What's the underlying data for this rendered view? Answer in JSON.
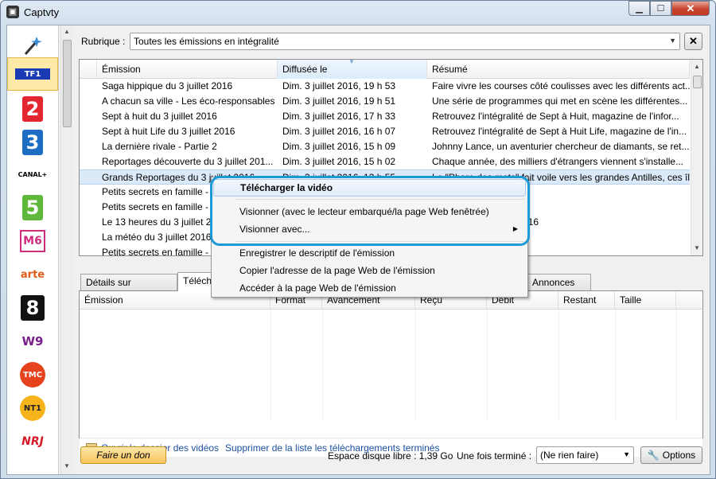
{
  "window": {
    "title": "Captvty"
  },
  "channels": [
    {
      "name": "magic-wand",
      "label": ""
    },
    {
      "name": "tf1",
      "label": "TF1"
    },
    {
      "name": "france-2",
      "label": "2"
    },
    {
      "name": "france-3",
      "label": "3"
    },
    {
      "name": "canal-plus",
      "label": "CANAL+"
    },
    {
      "name": "france-5",
      "label": "5"
    },
    {
      "name": "m6",
      "label": "M6"
    },
    {
      "name": "arte",
      "label": "arte"
    },
    {
      "name": "d8",
      "label": "8"
    },
    {
      "name": "w9",
      "label": "W9"
    },
    {
      "name": "tmc",
      "label": "TMC"
    },
    {
      "name": "nt1",
      "label": "NT1"
    },
    {
      "name": "nrj12",
      "label": "NRJ"
    }
  ],
  "rubrique": {
    "label": "Rubrique :",
    "value": "Toutes les émissions en intégralité",
    "close": "✕"
  },
  "table": {
    "headers": [
      "Émission",
      "Diffusée le",
      "Résumé"
    ],
    "rows": [
      [
        "Saga hippique du 3 juillet 2016",
        "Dim. 3 juillet 2016, 19 h 53",
        "Faire vivre les courses côté coulisses avec les différents act..."
      ],
      [
        "A chacun sa ville - Les éco-responsables",
        "Dim. 3 juillet 2016, 19 h 51",
        "Une série de programmes qui met en scène les différentes..."
      ],
      [
        "Sept à huit du 3 juillet 2016",
        "Dim. 3 juillet 2016, 17 h 33",
        "Retrouvez l'intégralité de Sept à Huit, magazine de l'infor..."
      ],
      [
        "Sept à huit Life du 3 juillet 2016",
        "Dim. 3 juillet 2016, 16 h 07",
        "Retrouvez l'intégralité de Sept à Huit Life, magazine de l'in..."
      ],
      [
        "La dernière rivale - Partie 2",
        "Dim. 3 juillet 2016, 15 h 09",
        "Johnny Lance, un aventurier chercheur de diamants, se ret..."
      ],
      [
        "Reportages découverte du 3 juillet 201...",
        "Dim. 3 juillet 2016, 15 h 02",
        "Chaque année,  des milliers d'étrangers viennent s'installe..."
      ],
      [
        "Grands Reportages du 3 juillet 2016",
        "Dim. 3 juillet 2016, 13 h 55",
        "Le \"Phare des mots\" fait voile vers les grandes Antilles, ces îl..."
      ],
      [
        "Petits secrets en famille - E",
        "",
        ""
      ],
      [
        "Petits secrets en famille - E",
        "",
        ""
      ],
      [
        "Le 13 heures du 3 juillet 20",
        "",
        "3 heures du 3 juillet 2016"
      ],
      [
        "La météo du 3 juillet 2016",
        "",
        "3 juillet 2016 - 12h45"
      ],
      [
        "Petits secrets en famille - E",
        "",
        ""
      ]
    ]
  },
  "tabs": [
    "Détails sur l'émission",
    "Téléchargements",
    "Annonces (4)"
  ],
  "downloads": {
    "headers": [
      "Émission",
      "Format",
      "Avancement",
      "Reçu",
      "Débit",
      "Restant",
      "Taille"
    ]
  },
  "actions": {
    "open_folder": "Ouvrir le dossier des vidéos",
    "clear_list": "Supprimer de la liste les téléchargements terminés"
  },
  "bottom": {
    "donate": "Faire un don",
    "disk_space": "Espace disque libre : 1,39 Go",
    "when_done_label": "Une fois terminé :",
    "when_done_value": "(Ne rien faire)",
    "options": "Options"
  },
  "context_menu": {
    "items": [
      "Télécharger la vidéo",
      "Visionner (avec le lecteur embarqué/la page Web fenêtrée)",
      "Visionner avec...",
      "Enregistrer le descriptif de l'émission",
      "Copier l'adresse de la page Web de l'émission",
      "Accéder à la page Web de l'émission"
    ]
  },
  "colors": {
    "accent": "#1b9ad6",
    "selection": "#dce9f8",
    "link": "#1a4fa0"
  }
}
